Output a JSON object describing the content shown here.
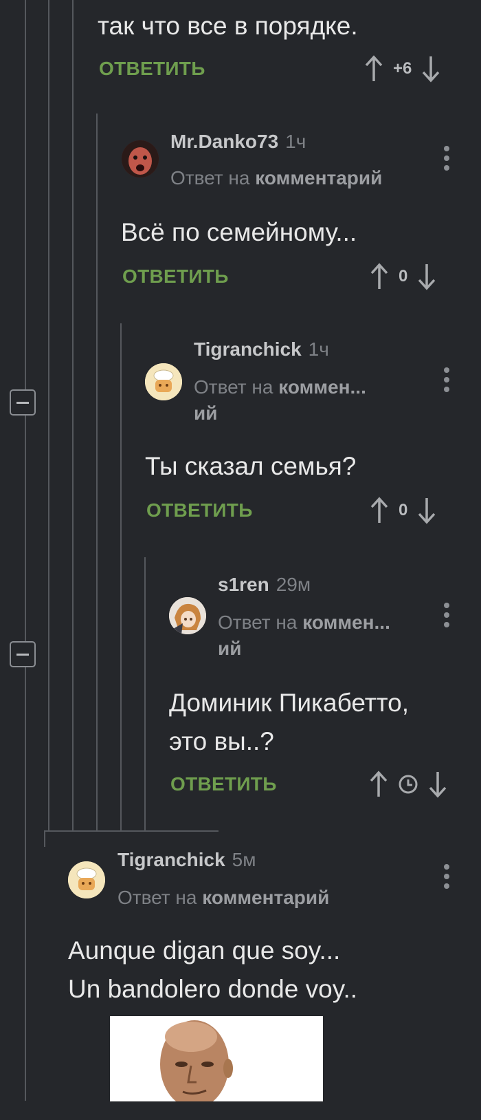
{
  "thread": {
    "top_partial": {
      "text": "так что все в порядке.",
      "reply_label": "ОТВЕТИТЬ",
      "score": "+6"
    },
    "comments": [
      {
        "author": "Mr.Danko73",
        "time": "1ч",
        "reply_prefix": "Ответ на",
        "reply_target": "комментарий",
        "text": "Всё по семейному...",
        "reply_label": "ОТВЕТИТЬ",
        "score": "0"
      },
      {
        "author": "Tigranchick",
        "time": "1ч",
        "reply_prefix": "Ответ на",
        "reply_target": "коммен...",
        "reply_target_cont": "ий",
        "text": "Ты сказал семья?",
        "reply_label": "ОТВЕТИТЬ",
        "score": "0"
      },
      {
        "author": "s1ren",
        "time": "29м",
        "reply_prefix": "Ответ на",
        "reply_target": "коммен...",
        "reply_target_cont": "ий",
        "text_line1": "Доминик Пикабетто,",
        "text_line2": "это вы..?",
        "reply_label": "ОТВЕТИТЬ",
        "score_icon": "clock-icon"
      },
      {
        "author": "Tigranchick",
        "time": "5м",
        "reply_prefix": "Ответ на",
        "reply_target": "комментарий",
        "text_line1": "Aunque digan que soy...",
        "text_line2": "Un bandolero donde voy..",
        "has_image": true
      }
    ]
  },
  "icons": {
    "upvote": "arrow-up-icon",
    "downvote": "arrow-down-icon",
    "menu": "more-vertical-icon",
    "collapse": "minus-square-icon"
  },
  "colors": {
    "background": "#25272b",
    "reply_link": "#6f9e4e",
    "thread_line": "#55585d"
  }
}
